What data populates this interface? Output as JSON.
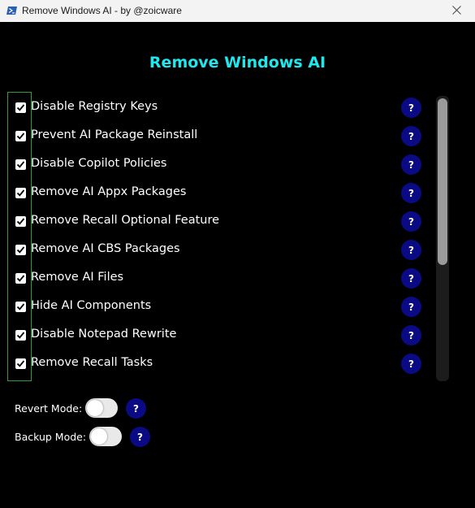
{
  "window": {
    "title": "Remove Windows AI - by @zoicware",
    "close_glyph": "✕"
  },
  "app": {
    "heading": "Remove Windows AI"
  },
  "options": [
    {
      "label": "Disable Registry Keys",
      "checked": true,
      "help": "?"
    },
    {
      "label": "Prevent AI Package Reinstall",
      "checked": true,
      "help": "?"
    },
    {
      "label": "Disable Copilot Policies",
      "checked": true,
      "help": "?"
    },
    {
      "label": "Remove AI Appx Packages",
      "checked": true,
      "help": "?"
    },
    {
      "label": "Remove Recall Optional Feature",
      "checked": true,
      "help": "?"
    },
    {
      "label": "Remove AI CBS Packages",
      "checked": true,
      "help": "?"
    },
    {
      "label": "Remove AI Files",
      "checked": true,
      "help": "?"
    },
    {
      "label": "Hide AI Components",
      "checked": true,
      "help": "?"
    },
    {
      "label": "Disable Notepad Rewrite",
      "checked": true,
      "help": "?"
    },
    {
      "label": "Remove Recall Tasks",
      "checked": true,
      "help": "?"
    }
  ],
  "modes": {
    "revert": {
      "label": "Revert Mode:",
      "enabled": false,
      "help": "?"
    },
    "backup": {
      "label": "Backup Mode:",
      "enabled": false,
      "help": "?"
    }
  },
  "colors": {
    "background": "#000000",
    "heading": "#1ee8ee",
    "help_button": "#0a0a85",
    "highlight_border": "#2f9c3c"
  },
  "icons": {
    "app": "powershell-icon",
    "close": "close-icon",
    "checkbox": "checkmark-icon"
  }
}
